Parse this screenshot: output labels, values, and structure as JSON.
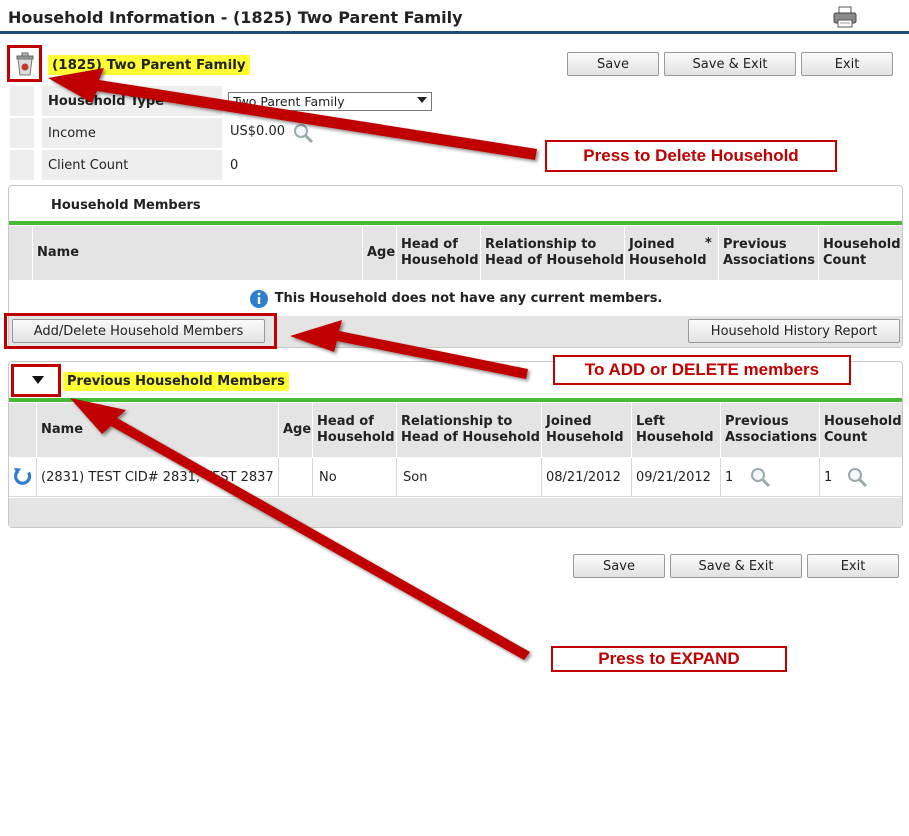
{
  "header": {
    "title": "Household Information - (1825) Two Parent Family",
    "print_icon": "printer-icon"
  },
  "actions": {
    "save": "Save",
    "save_exit": "Save & Exit",
    "exit": "Exit"
  },
  "household": {
    "name": "(1825) Two Parent Family",
    "delete_icon": "trash-icon",
    "type_label": "Household Type",
    "type_value": "Two Parent Family",
    "income_label": "Income",
    "income_value": "US$0.00",
    "client_count_label": "Client Count",
    "client_count_value": "0"
  },
  "members": {
    "title": "Household Members",
    "columns": {
      "name": "Name",
      "age": "Age",
      "head": "Head of Household",
      "relationship": "Relationship to Head of Household",
      "joined": "Joined Household",
      "required_mark": "*",
      "previous": "Previous Associations",
      "count": "Household Count"
    },
    "empty_message": "This Household does not have any current members.",
    "add_delete_button": "Add/Delete Household Members",
    "history_button": "Household History Report"
  },
  "previous": {
    "title": "Previous Household Members",
    "columns": {
      "name": "Name",
      "age": "Age",
      "head": "Head of Household",
      "relationship": "Relationship to Head of Household",
      "joined": "Joined Household",
      "left": "Left Household",
      "previous": "Previous Associations",
      "count": "Household Count"
    },
    "rows": [
      {
        "name": "(2831) TEST CID# 2831, TEST 2837",
        "age": "",
        "head": "No",
        "relationship": "Son",
        "joined": "08/21/2012",
        "left": "09/21/2012",
        "previous": "1",
        "count": "1"
      }
    ]
  },
  "annotations": {
    "delete": "Press to Delete Household",
    "add_delete": "To ADD or DELETE members",
    "expand": "Press to EXPAND"
  },
  "colors": {
    "header_rule": "#1f4e79",
    "highlight": "#ffff33",
    "accent_green": "#44bb33",
    "annotation_red": "#c00000"
  }
}
